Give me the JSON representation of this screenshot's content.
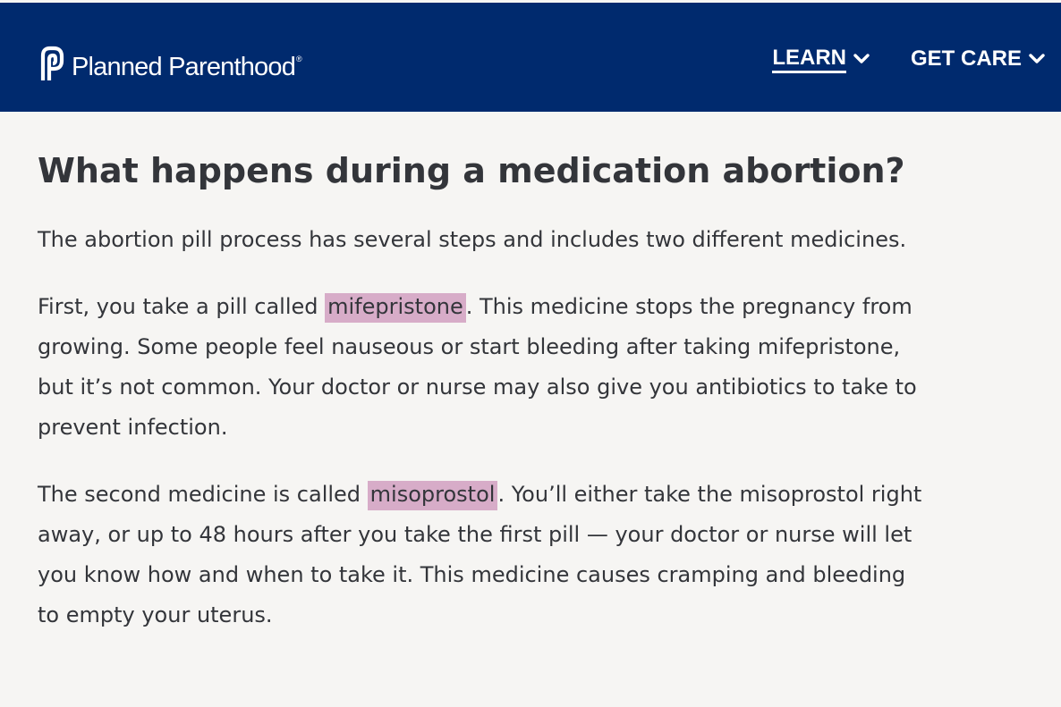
{
  "header": {
    "logo_text": "Planned Parenthood",
    "logo_registered": "®",
    "nav": [
      {
        "label": "LEARN",
        "active": true,
        "icon": "chevron-down-icon"
      },
      {
        "label": "GET CARE",
        "active": false,
        "icon": "chevron-down-icon"
      }
    ],
    "background_color": "#002a6e"
  },
  "article": {
    "title": "What happens during a medication abortion?",
    "intro": "The abortion pill process has several steps and includes two different medicines.",
    "p2_before": "First, you take a pill called ",
    "p2_highlight": "mifepristone",
    "p2_after": ". This medicine stops the pregnancy from growing.  Some people feel nauseous or start bleeding after taking mifepristone, but it’s not common. Your doctor or nurse may also give you antibiotics to take to prevent infection.",
    "p3_before": "The second medicine is called ",
    "p3_highlight": "misoprostol",
    "p3_after": ". You’ll either take the misoprostol right away, or up to 48 hours after you take the first pill — your doctor or nurse will let you know how and when to take it. This medicine causes cramping and bleeding to empty your uterus."
  },
  "colors": {
    "text": "#33353a",
    "highlight": "#d7acc8",
    "page_background": "#f6f5f3"
  }
}
